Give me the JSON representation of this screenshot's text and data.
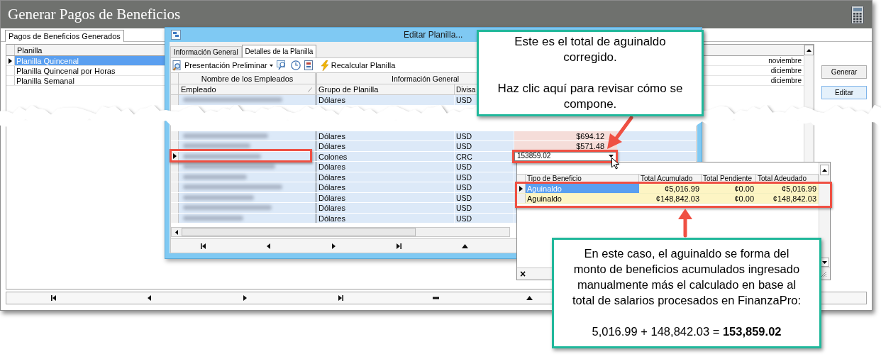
{
  "main_window": {
    "title": "Generar Pagos de Beneficios",
    "tabs": [
      {
        "label": "Pagos de Beneficios Generados",
        "selected": true
      }
    ],
    "table": {
      "columns": [
        "Planilla"
      ],
      "rows": [
        {
          "planilla": "Planilla Quincenal",
          "column_2": "noviembre",
          "selected": true
        },
        {
          "planilla": "Planilla Quincenal por Horas",
          "column_2": "diciembre",
          "selected": false
        },
        {
          "planilla": "Planilla Semanal",
          "column_2": "diciembre",
          "selected": false
        }
      ]
    },
    "buttons": [
      {
        "label": "Generar",
        "focused": false
      },
      {
        "label": "Editar",
        "focused": true
      }
    ]
  },
  "edit_window": {
    "title": "Editar Planilla...",
    "tabs": [
      {
        "label": "Información General",
        "selected": false
      },
      {
        "label": "Detalles de la Planilla",
        "selected": true
      }
    ],
    "toolbar": {
      "preview_label": "Presentación Preliminar",
      "recalculate_label": "Recalcular Planilla"
    },
    "grid": {
      "bands": [
        "Nombre de los Empleados",
        "Información General"
      ],
      "columns": [
        "Empleado",
        "Grupo de Planilla",
        "Divisa"
      ],
      "rows_above_break": [
        {
          "group": "Dólares",
          "currency": "USD",
          "selected": false
        }
      ],
      "rows_below_break": [
        {
          "group": "Dólares",
          "currency": "USD",
          "amount": "$694.12",
          "selected": false
        },
        {
          "group": "Dólares",
          "currency": "USD",
          "amount": "$571.48",
          "selected": false
        },
        {
          "group": "Colones",
          "currency": "CRC",
          "editor_value": "153859.02",
          "selected": true
        },
        {
          "group": "Dólares",
          "currency": "USD",
          "selected": false
        },
        {
          "group": "Dólares",
          "currency": "USD",
          "selected": false
        },
        {
          "group": "Dólares",
          "currency": "USD",
          "selected": false
        },
        {
          "group": "Dólares",
          "currency": "USD",
          "selected": false
        },
        {
          "group": "Dólares",
          "currency": "USD",
          "selected": false
        },
        {
          "group": "Dólares",
          "currency": "USD",
          "selected": false
        }
      ]
    }
  },
  "dropdown": {
    "columns": [
      "Tipo de Beneficio",
      "Total Acumulado",
      "Total Pendiente",
      "Total Adeudado"
    ],
    "rows": [
      {
        "type": "Aguinaldo",
        "accumulated": "¢5,016.99",
        "pending": "¢0.00",
        "owed": "¢5,016.99",
        "selected": true
      },
      {
        "type": "Aguinaldo",
        "accumulated": "¢148,842.03",
        "pending": "¢0.00",
        "owed": "¢148,842.03",
        "selected": false
      }
    ],
    "close_label": "×"
  },
  "callouts": [
    {
      "paragraphs": [
        "Este es el total de aguinaldo corregido.",
        "Haz clic aquí para revisar cómo se compone."
      ]
    },
    {
      "paragraphs": [
        "En este caso, el aguinaldo se forma del monto de beneficios acumulados ingresado manualmente más el calculado en base al total de salarios procesados en FinanzaPro:",
        "5,016.99 + 148,842.03 = **153,859.02**"
      ]
    }
  ]
}
